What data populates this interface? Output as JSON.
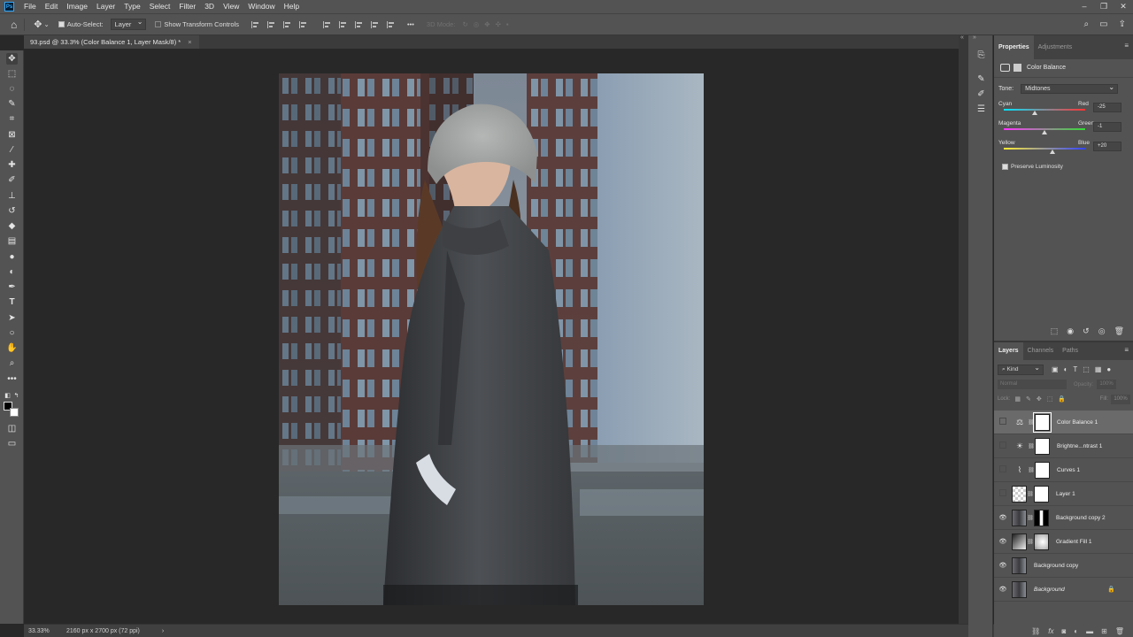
{
  "menu": {
    "logo": "Ps",
    "items": [
      "File",
      "Edit",
      "Image",
      "Layer",
      "Type",
      "Select",
      "Filter",
      "3D",
      "View",
      "Window",
      "Help"
    ],
    "window_controls": [
      "–",
      "❐",
      "✕"
    ]
  },
  "options": {
    "auto_select_label": "Auto-Select:",
    "auto_select_checked": true,
    "auto_select_target": "Layer",
    "transform_controls_label": "Show Transform Controls",
    "transform_controls_checked": false,
    "mode_3d_label": "3D Mode:",
    "more_label": "•••"
  },
  "document": {
    "tab_title": "93.psd @ 33.3% (Color Balance 1, Layer Mask/8) *",
    "close_glyph": "×"
  },
  "status": {
    "zoom": "33.33%",
    "dimensions": "2160 px x 2700 px (72 ppi)",
    "arrow": "›"
  },
  "properties": {
    "tabs": [
      "Properties",
      "Adjustments"
    ],
    "active_tab": "Properties",
    "header_label": "Color Balance",
    "tone_label": "Tone:",
    "tone_value": "Midtones",
    "sliders": [
      {
        "left": "Cyan",
        "right": "Red",
        "value": "-25",
        "level": -25,
        "gradient": [
          "#00e5ff",
          "#ff3333"
        ]
      },
      {
        "left": "Magenta",
        "right": "Green",
        "value": "-1",
        "level": -1,
        "gradient": [
          "#ff33ff",
          "#33dd33"
        ]
      },
      {
        "left": "Yellow",
        "right": "Blue",
        "value": "+20",
        "level": 20,
        "gradient": [
          "#ffee33",
          "#3344ff"
        ]
      }
    ],
    "preserve_luminosity_label": "Preserve Luminosity",
    "preserve_luminosity_checked": true
  },
  "layers_panel": {
    "tabs": [
      "Layers",
      "Channels",
      "Paths"
    ],
    "active_tab": "Layers",
    "filter_label": "Kind",
    "blend_mode": "Normal",
    "opacity_label": "Opacity:",
    "opacity_value": "100%",
    "lock_label": "Lock:",
    "fill_label": "Fill:",
    "fill_value": "100%",
    "layers": [
      {
        "name": "Color Balance 1",
        "visible": false,
        "type": "adjustment",
        "adj_icon": "color-balance-icon",
        "mask": "white",
        "selected": true
      },
      {
        "name": "Brightne...ntrast 1",
        "visible": false,
        "type": "adjustment",
        "adj_icon": "brightness-contrast-icon",
        "mask": "white",
        "selected": false
      },
      {
        "name": "Curves 1",
        "visible": false,
        "type": "adjustment",
        "adj_icon": "curves-icon",
        "mask": "white",
        "selected": false
      },
      {
        "name": "Layer 1",
        "visible": false,
        "type": "pixel",
        "thumb": "checker",
        "mask": "white",
        "selected": false
      },
      {
        "name": "Background copy 2",
        "visible": true,
        "type": "pixel",
        "thumb": "photo",
        "mask": "blackwhite",
        "selected": false
      },
      {
        "name": "Gradient Fill 1",
        "visible": true,
        "type": "fill",
        "thumb": "gradient",
        "mask": "radial",
        "selected": false
      },
      {
        "name": "Background copy",
        "visible": true,
        "type": "pixel",
        "thumb": "photo",
        "mask": null,
        "selected": false
      },
      {
        "name": "Background",
        "visible": true,
        "type": "pixel",
        "thumb": "photo",
        "mask": null,
        "selected": false,
        "locked": true,
        "italic": true
      }
    ]
  },
  "colors": {
    "accent": "#31a8ff",
    "panel_bg": "#535353",
    "canvas_bg": "#282828"
  }
}
